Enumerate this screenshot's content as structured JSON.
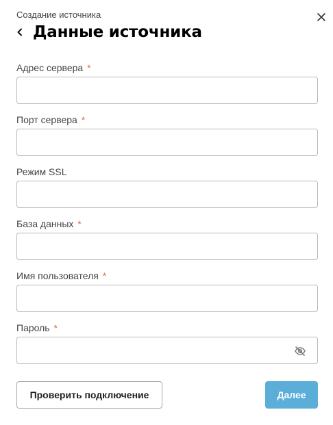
{
  "header": {
    "subtitle": "Создание источника",
    "title": "Данные источника"
  },
  "icons": {
    "back": "chevron-left-icon",
    "close": "close-icon",
    "password_visibility": "eye-off-icon"
  },
  "form": {
    "required_mark": "*",
    "fields": [
      {
        "label": "Адрес сервера",
        "required": true,
        "value": "",
        "placeholder": ""
      },
      {
        "label": "Порт сервера",
        "required": true,
        "value": "",
        "placeholder": ""
      },
      {
        "label": "Режим SSL",
        "required": false,
        "value": "",
        "placeholder": ""
      },
      {
        "label": "База данных",
        "required": true,
        "value": "",
        "placeholder": ""
      },
      {
        "label": "Имя пользователя",
        "required": true,
        "value": "",
        "placeholder": ""
      },
      {
        "label": "Пароль",
        "required": true,
        "value": "",
        "placeholder": ""
      }
    ]
  },
  "actions": {
    "check_connection_label": "Проверить подключение",
    "next_label": "Далее"
  },
  "colors": {
    "required_mark": "#e06650",
    "primary_button": "#5aaed8",
    "input_border": "#b8b8b8"
  }
}
